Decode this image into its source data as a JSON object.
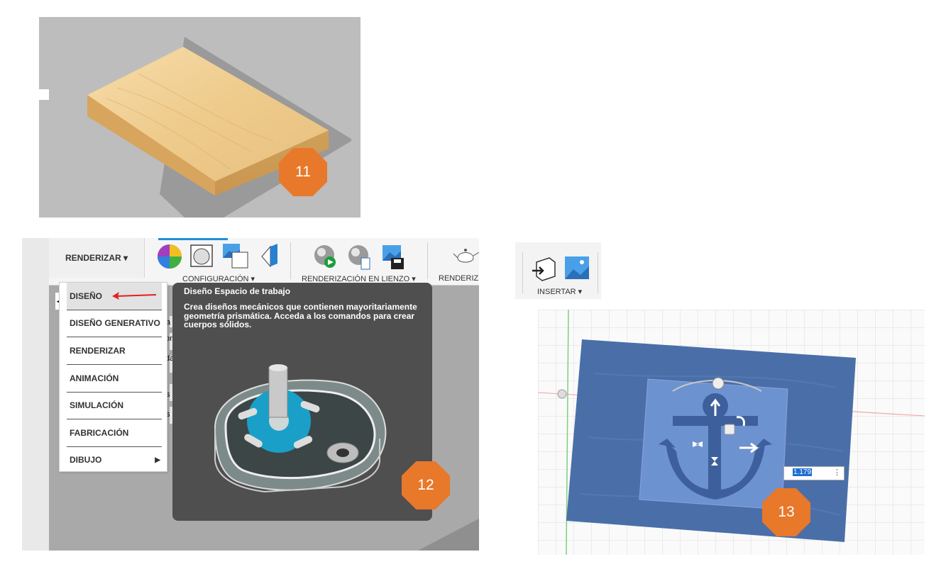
{
  "panel11": {
    "badge": "11"
  },
  "panel12": {
    "toolbar": {
      "workspace_button": "RENDERIZAR ▾",
      "groups": [
        {
          "label": "CONFIGURACIÓN ▾"
        },
        {
          "label": "RENDERIZACIÓN EN LIENZO ▾"
        },
        {
          "label": "RENDERIZ"
        }
      ]
    },
    "menu": {
      "items": [
        {
          "label": "DISEÑO"
        },
        {
          "label": "DISEÑO GENERATIVO"
        },
        {
          "label": "RENDERIZAR"
        },
        {
          "label": "ANIMACIÓN"
        },
        {
          "label": "SIMULACIÓN"
        },
        {
          "label": "FABRICACIÓN"
        },
        {
          "label": "DIBUJO"
        }
      ]
    },
    "tooltip": {
      "title": "Diseño Espacio de trabajo",
      "body": "Crea diseños mecánicos que contienen mayoritariamente geometría prismática. Acceda a los comandos para crear cuerpos sólidos."
    },
    "partial_text": [
      "a",
      "on",
      "da",
      "s",
      "s"
    ],
    "badge": "12"
  },
  "panel13": {
    "insert_label": "INSERTAR ▾",
    "value_input": "1.179",
    "badge": "13"
  },
  "colors": {
    "badge": "#e8782a",
    "wood": "#f0cf95",
    "canvas_blue": "#4a6fa8",
    "tooltip_bg": "#4f4f4f",
    "arrow_red": "#e02020"
  }
}
